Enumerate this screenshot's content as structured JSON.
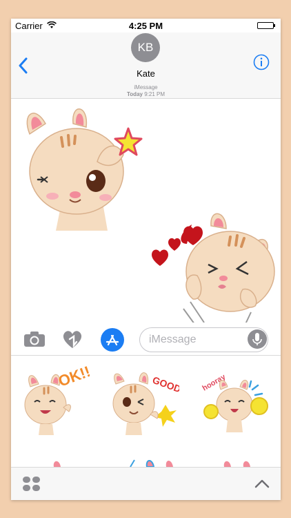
{
  "status_bar": {
    "carrier": "Carrier",
    "time": "4:25 PM"
  },
  "nav": {
    "avatar_initials": "KB",
    "contact_name": "Kate"
  },
  "thread": {
    "service": "iMessage",
    "day": "Today",
    "time": "9:21 PM"
  },
  "composer": {
    "placeholder": "iMessage"
  },
  "sticker_text": {
    "ok": "OK!!",
    "good": "GOOD",
    "hooray": "hooray"
  },
  "colors": {
    "accent": "#1b7df3",
    "background": "#f2cfae",
    "sticker_skin": "#f5dcc0",
    "sticker_ear": "#f28b9a"
  }
}
